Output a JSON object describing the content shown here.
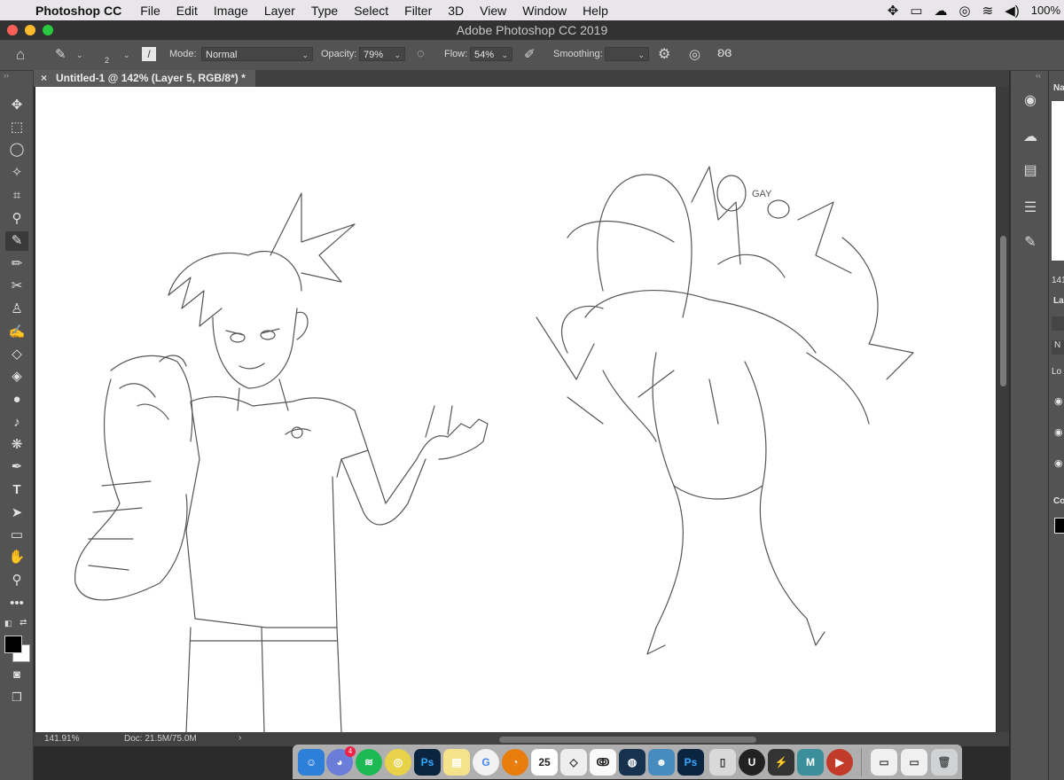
{
  "menubar": {
    "app_name": "Photoshop CC",
    "items": [
      "File",
      "Edit",
      "Image",
      "Layer",
      "Type",
      "Select",
      "Filter",
      "3D",
      "View",
      "Window",
      "Help"
    ],
    "battery": "100%"
  },
  "window": {
    "title": "Adobe Photoshop CC 2019"
  },
  "options_bar": {
    "brush_size": "2",
    "mode_label": "Mode:",
    "mode_value": "Normal",
    "opacity_label": "Opacity:",
    "opacity_value": "79%",
    "flow_label": "Flow:",
    "flow_value": "54%",
    "smoothing_label": "Smoothing:",
    "smoothing_value": ""
  },
  "document": {
    "tab_title": "Untitled-1 @ 142% (Layer 5, RGB/8*) *",
    "canvas_text": "GAY"
  },
  "status": {
    "zoom": "141.91%",
    "doc_size": "Doc: 21.5M/75.0M",
    "arrow": "›"
  },
  "panels": {
    "navigator_label": "Na",
    "zoom_short": "141",
    "layers_label": "La",
    "blend_short": "N",
    "lock_short": "Lo",
    "color_label": "Co"
  },
  "dock": {
    "calendar_day": "25",
    "discord_badge": "4",
    "maya_label": "M"
  },
  "colors": {
    "accent": "#0f72d8",
    "foreground": "#000000",
    "background": "#ffffff"
  }
}
